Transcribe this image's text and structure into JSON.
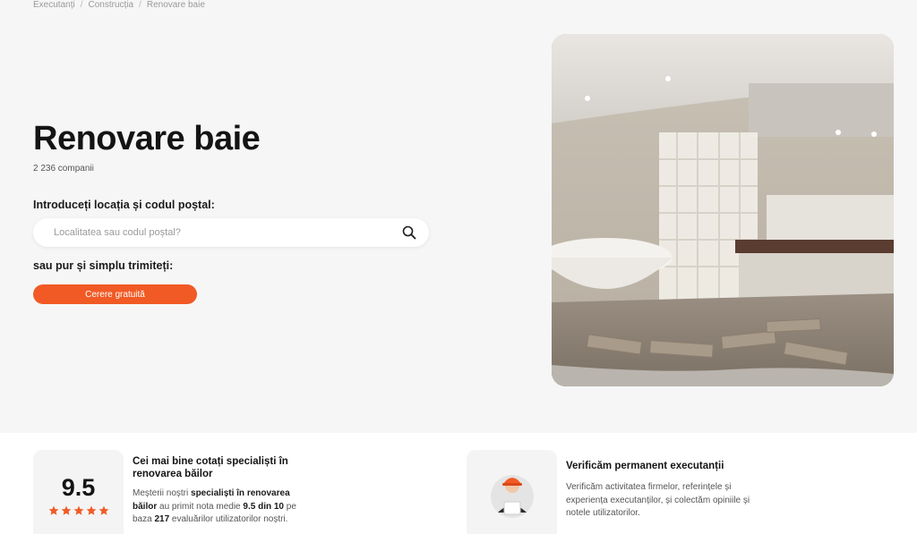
{
  "breadcrumb": {
    "items": [
      "Executanți",
      "Construcția",
      "Renovare baie"
    ],
    "separator": "/"
  },
  "page": {
    "title": "Renovare baie",
    "count": "2 236 companii"
  },
  "search": {
    "label": "Introduceți locația și codul poștal:",
    "placeholder": "Localitatea sau codul poștal?",
    "value": "",
    "icon": "search-icon"
  },
  "cta": {
    "lead": "sau pur și simplu trimiteți:",
    "button_label": "Cerere gratuită",
    "color": "#f15a24"
  },
  "hero": {
    "image": "bathroom-renovation-photo"
  },
  "rating": {
    "score": "9.5",
    "stars": 5,
    "title": "Cei mai bine cotați specialiști în renovarea băilor",
    "text_1": "Meșterii noștri ",
    "text_strong_1": "specialiști în renovarea băilor",
    "text_2": " au primit nota medie ",
    "text_strong_2": "9.5 din 10",
    "text_3": " pe baza ",
    "text_strong_3": "217",
    "text_4": " evaluărilor utilizatorilor noștri."
  },
  "verify": {
    "icon": "worker-icon",
    "title": "Verificăm permanent executanții",
    "text": "Verificăm activitatea firmelor, referințele și experiența executanților, și colectăm opiniile și notele utilizatorilor."
  }
}
